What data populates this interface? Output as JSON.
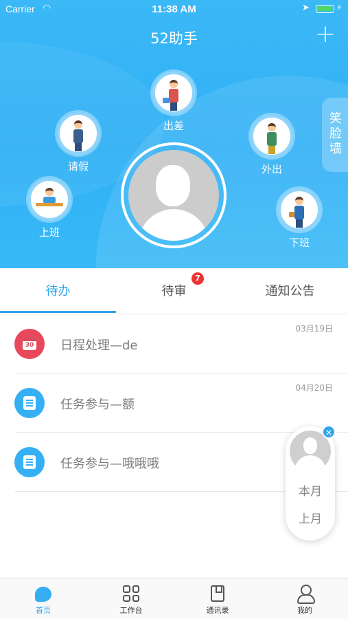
{
  "status_bar": {
    "carrier": "Carrier",
    "time": "11:38 AM",
    "wifi_icon": "wifi-icon",
    "location_icon": "location-arrow-icon",
    "battery_icon": "battery-charging-icon"
  },
  "header": {
    "title": "52助手",
    "add_icon": "plus-icon",
    "smile_wall": [
      "笑",
      "脸",
      "墙"
    ]
  },
  "actions": {
    "business_trip": "出差",
    "leave": "请假",
    "go_out": "外出",
    "clock_in": "上班",
    "clock_out": "下班"
  },
  "tabs": [
    {
      "label": "待办",
      "active": true
    },
    {
      "label": "待审",
      "active": false,
      "badge": "7"
    },
    {
      "label": "通知公告",
      "active": false
    }
  ],
  "todo_items": [
    {
      "title": "日程处理—de",
      "date": "03月19日",
      "icon": "calendar-icon",
      "icon_text": "30",
      "icon_color": "#e8485c"
    },
    {
      "title": "任务参与—额",
      "date": "04月20日",
      "icon": "task-list-icon",
      "icon_color": "#35b0f4"
    },
    {
      "title": "任务参与—哦哦哦",
      "date": "",
      "icon": "task-list-icon",
      "icon_color": "#35b0f4"
    }
  ],
  "float_card": {
    "this_month": "本月",
    "last_month": "上月",
    "close_icon": "close-icon"
  },
  "tabbar": [
    {
      "label": "首页",
      "icon": "home-chat-icon",
      "active": true
    },
    {
      "label": "工作台",
      "icon": "grid-icon",
      "active": false
    },
    {
      "label": "通讯录",
      "icon": "contacts-book-icon",
      "active": false
    },
    {
      "label": "我的",
      "icon": "user-icon",
      "active": false
    }
  ],
  "colors": {
    "header_blue": "#33b3f5",
    "accent": "#2fa5ea",
    "badge_red": "#e33333"
  }
}
